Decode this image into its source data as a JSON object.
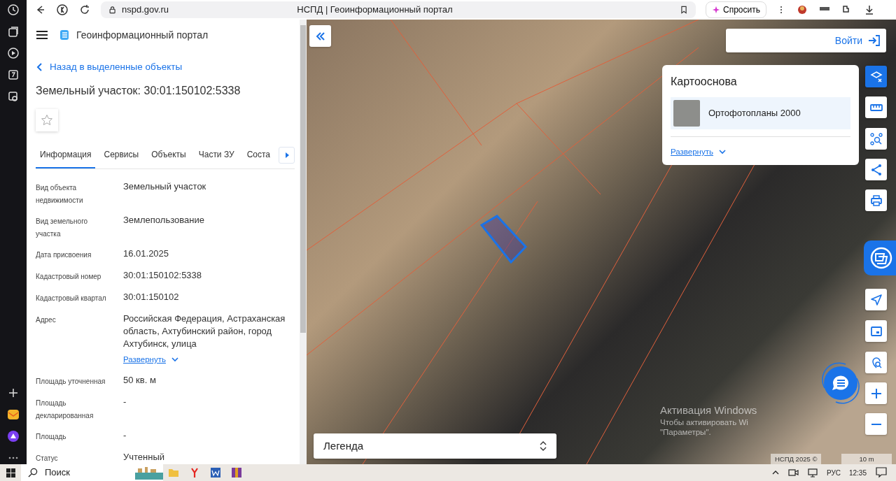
{
  "browser": {
    "address": "nspd.gov.ru",
    "title": "НСПД | Геоинформационный портал",
    "ask_button": "Спросить"
  },
  "panel": {
    "portal_title": "Геоинформационный портал",
    "back_link": "Назад в выделенные объекты",
    "heading": "Земельный участок: 30:01:150102:5338",
    "favorite": false,
    "tabs": [
      {
        "label": "Информация",
        "selected": true
      },
      {
        "label": "Сервисы",
        "selected": false
      },
      {
        "label": "Объекты",
        "selected": false
      },
      {
        "label": "Части ЗУ",
        "selected": false
      },
      {
        "label": "Соста",
        "selected": false
      }
    ],
    "fields": [
      {
        "label": "Вид объекта недвижимости",
        "value": "Земельный участок"
      },
      {
        "label": "Вид земельного участка",
        "value": "Землепользование"
      },
      {
        "label": "Дата присвоения",
        "value": "16.01.2025"
      },
      {
        "label": "Кадастровый номер",
        "value": "30:01:150102:5338"
      },
      {
        "label": "Кадастровый квартал",
        "value": "30:01:150102"
      },
      {
        "label": "Адрес",
        "value": "Российская Федерация, Астраханская область, Ахтубинский район, город Ахтубинск, улица",
        "expand_link": "Развернуть"
      },
      {
        "label": "Площадь уточненная",
        "value": "50 кв. м"
      },
      {
        "label": "Площадь декларированная",
        "value": "-"
      },
      {
        "label": "Площадь",
        "value": "-"
      },
      {
        "label": "Статус",
        "value": "Учтенный"
      }
    ]
  },
  "map": {
    "login_button": "Войти",
    "basemap": {
      "title": "Картооснова",
      "item": "Ортофотопланы 2000",
      "expand_link": "Развернуть"
    },
    "tools": [
      {
        "kind": "layers",
        "selected": true
      },
      {
        "kind": "ruler",
        "selected": false
      },
      {
        "kind": "select",
        "selected": false
      },
      {
        "kind": "share",
        "selected": false
      },
      {
        "kind": "print",
        "selected": false
      },
      {
        "kind": "locate",
        "selected": false
      },
      {
        "kind": "minimap",
        "selected": false
      },
      {
        "kind": "search-point",
        "selected": false
      },
      {
        "kind": "zoom-in",
        "selected": false
      },
      {
        "kind": "zoom-out",
        "selected": false
      }
    ],
    "legend": "Легенда",
    "attribution": "НСПД 2025 ©",
    "scale": "10 m"
  },
  "activation_notice": {
    "title": "Активация Windows",
    "line_1": "Чтобы активировать Wi",
    "line_2": "\"Параметры\"."
  },
  "taskbar": {
    "search": "Поиск",
    "language": "РУС",
    "time": "12:35"
  }
}
